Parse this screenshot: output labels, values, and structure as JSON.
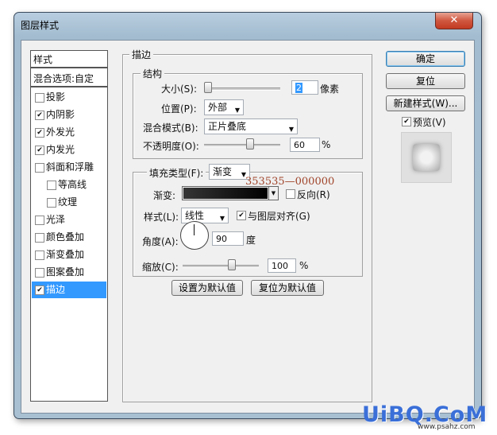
{
  "window": {
    "title": "图层样式",
    "close_icon": "close-icon"
  },
  "left_panel": {
    "header": "样式",
    "blend_options": "混合选项:自定",
    "items": [
      {
        "label": "投影",
        "checked": false
      },
      {
        "label": "内阴影",
        "checked": true
      },
      {
        "label": "外发光",
        "checked": true
      },
      {
        "label": "内发光",
        "checked": true
      },
      {
        "label": "斜面和浮雕",
        "checked": false
      },
      {
        "label": "等高线",
        "checked": false
      },
      {
        "label": "纹理",
        "checked": false
      },
      {
        "label": "光泽",
        "checked": false
      },
      {
        "label": "颜色叠加",
        "checked": false
      },
      {
        "label": "渐变叠加",
        "checked": false
      },
      {
        "label": "图案叠加",
        "checked": false
      },
      {
        "label": "描边",
        "checked": true,
        "selected": true
      }
    ]
  },
  "stroke": {
    "title": "描边",
    "structure": {
      "title": "结构",
      "size_label": "大小(S):",
      "size_value": "2",
      "size_unit": "像素",
      "size_fraction": 0.0,
      "position_label": "位置(P):",
      "position_value": "外部",
      "blend_label": "混合模式(B):",
      "blend_value": "正片叠底",
      "opacity_label": "不透明度(O):",
      "opacity_value": "60",
      "opacity_unit": "%"
    },
    "fill": {
      "type_label": "填充类型(F):",
      "type_value": "渐变",
      "annotation": "353535—000000",
      "gradient_label": "渐变:",
      "gradient_start": "#353535",
      "gradient_end": "#000000",
      "reverse_label": "反向(R)",
      "reverse_checked": false,
      "style_label": "样式(L):",
      "style_value": "线性",
      "align_label": "与图层对齐(G)",
      "align_checked": true,
      "angle_label": "角度(A):",
      "angle_value": "90",
      "angle_unit": "度",
      "scale_label": "缩放(C):",
      "scale_value": "100",
      "scale_unit": "%"
    },
    "default_button": "设置为默认值",
    "reset_default_button": "复位为默认值"
  },
  "right": {
    "ok_button": "确定",
    "reset_button": "复位",
    "new_style_button": "新建样式(W)...",
    "preview_label": "预览(V)",
    "preview_checked": true
  },
  "watermark": {
    "text": "UiBQ.CoM",
    "sub": "www.psahz.com"
  },
  "colors": {
    "selection": "#3399ff",
    "annotation": "#a0442a",
    "watermark_blue": "#3a6fd8",
    "watermark_green": "#4aa03a"
  }
}
